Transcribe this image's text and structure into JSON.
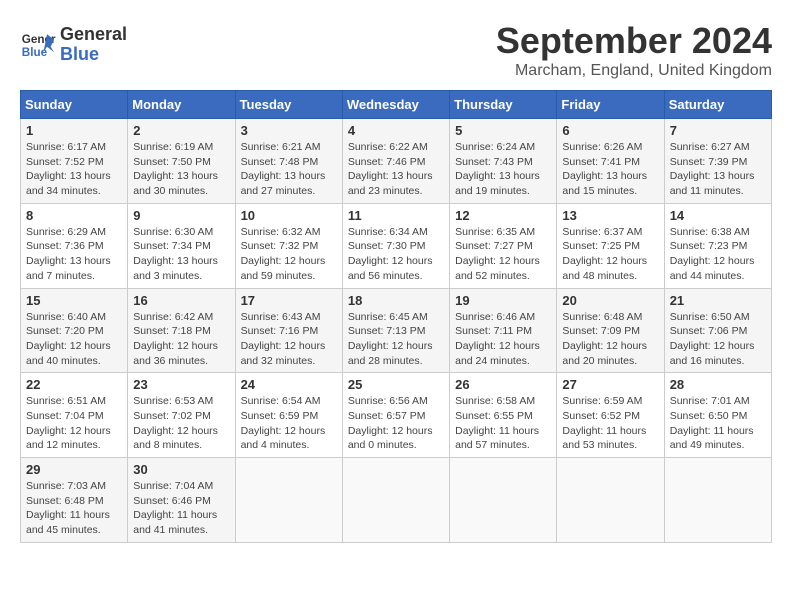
{
  "logo": {
    "line1": "General",
    "line2": "Blue"
  },
  "title": "September 2024",
  "subtitle": "Marcham, England, United Kingdom",
  "weekdays": [
    "Sunday",
    "Monday",
    "Tuesday",
    "Wednesday",
    "Thursday",
    "Friday",
    "Saturday"
  ],
  "weeks": [
    [
      {
        "day": "1",
        "sunrise": "Sunrise: 6:17 AM",
        "sunset": "Sunset: 7:52 PM",
        "daylight": "Daylight: 13 hours and 34 minutes."
      },
      {
        "day": "2",
        "sunrise": "Sunrise: 6:19 AM",
        "sunset": "Sunset: 7:50 PM",
        "daylight": "Daylight: 13 hours and 30 minutes."
      },
      {
        "day": "3",
        "sunrise": "Sunrise: 6:21 AM",
        "sunset": "Sunset: 7:48 PM",
        "daylight": "Daylight: 13 hours and 27 minutes."
      },
      {
        "day": "4",
        "sunrise": "Sunrise: 6:22 AM",
        "sunset": "Sunset: 7:46 PM",
        "daylight": "Daylight: 13 hours and 23 minutes."
      },
      {
        "day": "5",
        "sunrise": "Sunrise: 6:24 AM",
        "sunset": "Sunset: 7:43 PM",
        "daylight": "Daylight: 13 hours and 19 minutes."
      },
      {
        "day": "6",
        "sunrise": "Sunrise: 6:26 AM",
        "sunset": "Sunset: 7:41 PM",
        "daylight": "Daylight: 13 hours and 15 minutes."
      },
      {
        "day": "7",
        "sunrise": "Sunrise: 6:27 AM",
        "sunset": "Sunset: 7:39 PM",
        "daylight": "Daylight: 13 hours and 11 minutes."
      }
    ],
    [
      {
        "day": "8",
        "sunrise": "Sunrise: 6:29 AM",
        "sunset": "Sunset: 7:36 PM",
        "daylight": "Daylight: 13 hours and 7 minutes."
      },
      {
        "day": "9",
        "sunrise": "Sunrise: 6:30 AM",
        "sunset": "Sunset: 7:34 PM",
        "daylight": "Daylight: 13 hours and 3 minutes."
      },
      {
        "day": "10",
        "sunrise": "Sunrise: 6:32 AM",
        "sunset": "Sunset: 7:32 PM",
        "daylight": "Daylight: 12 hours and 59 minutes."
      },
      {
        "day": "11",
        "sunrise": "Sunrise: 6:34 AM",
        "sunset": "Sunset: 7:30 PM",
        "daylight": "Daylight: 12 hours and 56 minutes."
      },
      {
        "day": "12",
        "sunrise": "Sunrise: 6:35 AM",
        "sunset": "Sunset: 7:27 PM",
        "daylight": "Daylight: 12 hours and 52 minutes."
      },
      {
        "day": "13",
        "sunrise": "Sunrise: 6:37 AM",
        "sunset": "Sunset: 7:25 PM",
        "daylight": "Daylight: 12 hours and 48 minutes."
      },
      {
        "day": "14",
        "sunrise": "Sunrise: 6:38 AM",
        "sunset": "Sunset: 7:23 PM",
        "daylight": "Daylight: 12 hours and 44 minutes."
      }
    ],
    [
      {
        "day": "15",
        "sunrise": "Sunrise: 6:40 AM",
        "sunset": "Sunset: 7:20 PM",
        "daylight": "Daylight: 12 hours and 40 minutes."
      },
      {
        "day": "16",
        "sunrise": "Sunrise: 6:42 AM",
        "sunset": "Sunset: 7:18 PM",
        "daylight": "Daylight: 12 hours and 36 minutes."
      },
      {
        "day": "17",
        "sunrise": "Sunrise: 6:43 AM",
        "sunset": "Sunset: 7:16 PM",
        "daylight": "Daylight: 12 hours and 32 minutes."
      },
      {
        "day": "18",
        "sunrise": "Sunrise: 6:45 AM",
        "sunset": "Sunset: 7:13 PM",
        "daylight": "Daylight: 12 hours and 28 minutes."
      },
      {
        "day": "19",
        "sunrise": "Sunrise: 6:46 AM",
        "sunset": "Sunset: 7:11 PM",
        "daylight": "Daylight: 12 hours and 24 minutes."
      },
      {
        "day": "20",
        "sunrise": "Sunrise: 6:48 AM",
        "sunset": "Sunset: 7:09 PM",
        "daylight": "Daylight: 12 hours and 20 minutes."
      },
      {
        "day": "21",
        "sunrise": "Sunrise: 6:50 AM",
        "sunset": "Sunset: 7:06 PM",
        "daylight": "Daylight: 12 hours and 16 minutes."
      }
    ],
    [
      {
        "day": "22",
        "sunrise": "Sunrise: 6:51 AM",
        "sunset": "Sunset: 7:04 PM",
        "daylight": "Daylight: 12 hours and 12 minutes."
      },
      {
        "day": "23",
        "sunrise": "Sunrise: 6:53 AM",
        "sunset": "Sunset: 7:02 PM",
        "daylight": "Daylight: 12 hours and 8 minutes."
      },
      {
        "day": "24",
        "sunrise": "Sunrise: 6:54 AM",
        "sunset": "Sunset: 6:59 PM",
        "daylight": "Daylight: 12 hours and 4 minutes."
      },
      {
        "day": "25",
        "sunrise": "Sunrise: 6:56 AM",
        "sunset": "Sunset: 6:57 PM",
        "daylight": "Daylight: 12 hours and 0 minutes."
      },
      {
        "day": "26",
        "sunrise": "Sunrise: 6:58 AM",
        "sunset": "Sunset: 6:55 PM",
        "daylight": "Daylight: 11 hours and 57 minutes."
      },
      {
        "day": "27",
        "sunrise": "Sunrise: 6:59 AM",
        "sunset": "Sunset: 6:52 PM",
        "daylight": "Daylight: 11 hours and 53 minutes."
      },
      {
        "day": "28",
        "sunrise": "Sunrise: 7:01 AM",
        "sunset": "Sunset: 6:50 PM",
        "daylight": "Daylight: 11 hours and 49 minutes."
      }
    ],
    [
      {
        "day": "29",
        "sunrise": "Sunrise: 7:03 AM",
        "sunset": "Sunset: 6:48 PM",
        "daylight": "Daylight: 11 hours and 45 minutes."
      },
      {
        "day": "30",
        "sunrise": "Sunrise: 7:04 AM",
        "sunset": "Sunset: 6:46 PM",
        "daylight": "Daylight: 11 hours and 41 minutes."
      },
      {
        "day": "",
        "sunrise": "",
        "sunset": "",
        "daylight": ""
      },
      {
        "day": "",
        "sunrise": "",
        "sunset": "",
        "daylight": ""
      },
      {
        "day": "",
        "sunrise": "",
        "sunset": "",
        "daylight": ""
      },
      {
        "day": "",
        "sunrise": "",
        "sunset": "",
        "daylight": ""
      },
      {
        "day": "",
        "sunrise": "",
        "sunset": "",
        "daylight": ""
      }
    ]
  ]
}
